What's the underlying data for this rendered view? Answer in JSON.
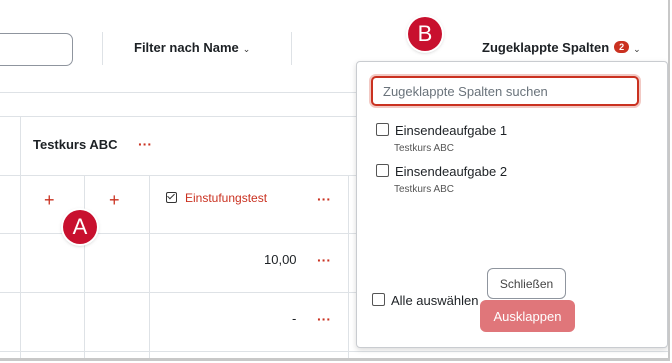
{
  "toolbar": {
    "filter_label": "Filter nach Name",
    "collapsed_label": "Zugeklappte Spalten",
    "collapsed_count": "2"
  },
  "grid": {
    "course_name": "Testkurs ABC",
    "menu_glyph": "···",
    "add_glyph": "+",
    "column_title": "Einstufungstest",
    "rows": [
      {
        "value": "10,00"
      },
      {
        "value": "-"
      }
    ]
  },
  "dropdown": {
    "search_placeholder": "Zugeklappte Spalten suchen",
    "options": [
      {
        "label": "Einsendeaufgabe 1",
        "course": "Testkurs ABC"
      },
      {
        "label": "Einsendeaufgabe 2",
        "course": "Testkurs ABC"
      }
    ],
    "select_all_label": "Alle auswählen",
    "close_label": "Schließen",
    "expand_label": "Ausklappen"
  },
  "callouts": {
    "a": "A",
    "b": "B"
  },
  "icons": {
    "chevron": "chevron-down-icon",
    "column_icon": "checkbox-checked-icon"
  },
  "colors": {
    "accent": "#ca3120",
    "callout": "#c8102e",
    "expand_button": "#e0767a"
  }
}
